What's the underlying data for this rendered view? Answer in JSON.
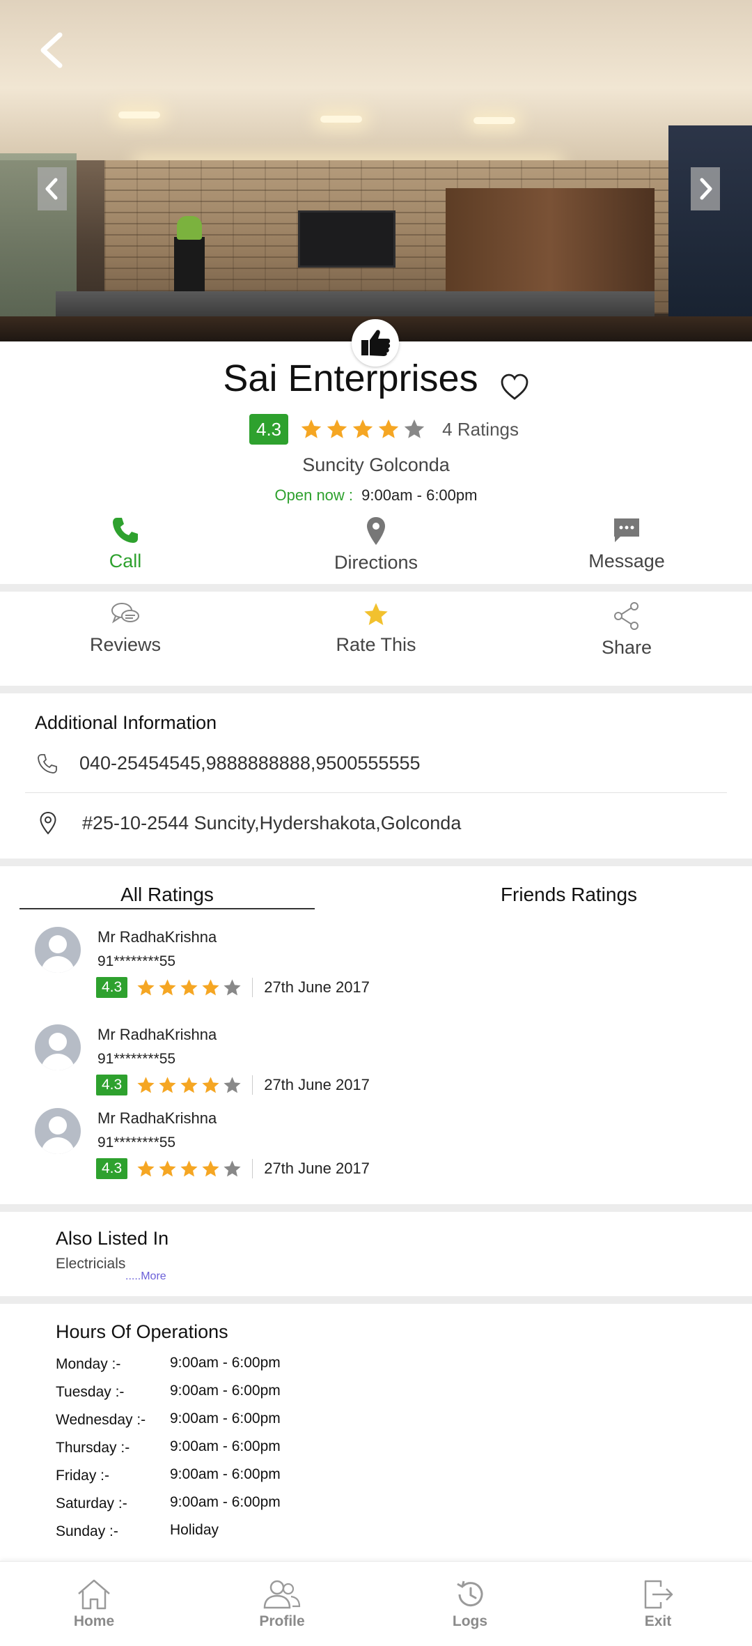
{
  "header": {
    "back_icon": "back-arrow-icon",
    "prev_icon": "chevron-left-icon",
    "next_icon": "chevron-right-icon",
    "badge_icon": "thumbs-up-icon"
  },
  "business": {
    "name": "Sai Enterprises",
    "rating": "4.3",
    "rating_value": 4.3,
    "ratings_count": "4 Ratings",
    "locality": "Suncity Golconda",
    "open_label": "Open now :",
    "open_hours": "9:00am - 6:00pm",
    "colors": {
      "green": "#2ea12e",
      "star": "#f5a623",
      "star_empty": "#888888",
      "rate_star": "#f2c12e"
    }
  },
  "actions": {
    "call": "Call",
    "directions": "Directions",
    "message": "Message",
    "reviews": "Reviews",
    "rate_this": "Rate This",
    "share": "Share"
  },
  "additional_info": {
    "title": "Additional Information",
    "phones": "040-25454545,9888888888,9500555555",
    "address": "#25-10-2544 Suncity,Hydershakota,Golconda"
  },
  "ratings_tabs": {
    "all": "All Ratings",
    "friends": "Friends Ratings"
  },
  "reviews": [
    {
      "name": "Mr RadhaKrishna",
      "phone": "91********55",
      "rating": "4.3",
      "stars": 4,
      "date": "27th June 2017"
    },
    {
      "name": "Mr RadhaKrishna",
      "phone": "91********55",
      "rating": "4.3",
      "stars": 4,
      "date": "27th June 2017"
    },
    {
      "name": "Mr RadhaKrishna",
      "phone": "91********55",
      "rating": "4.3",
      "stars": 4,
      "date": "27th June 2017"
    }
  ],
  "also_listed": {
    "title": "Also Listed In",
    "category": "Electricials",
    "more": ".....More"
  },
  "hours": {
    "title": "Hours Of Operations",
    "days": [
      {
        "day": "Monday :-",
        "time": "9:00am - 6:00pm"
      },
      {
        "day": "Tuesday :-",
        "time": "9:00am - 6:00pm"
      },
      {
        "day": "Wednesday :-",
        "time": "9:00am - 6:00pm"
      },
      {
        "day": "Thursday :-",
        "time": "9:00am - 6:00pm"
      },
      {
        "day": "Friday :-",
        "time": "9:00am - 6:00pm"
      },
      {
        "day": "Saturday :-",
        "time": "9:00am - 6:00pm"
      },
      {
        "day": "Sunday :-",
        "time": "Holiday"
      }
    ]
  },
  "bottom_nav": {
    "home": "Home",
    "profile": "Profile",
    "logs": "Logs",
    "exit": "Exit"
  }
}
